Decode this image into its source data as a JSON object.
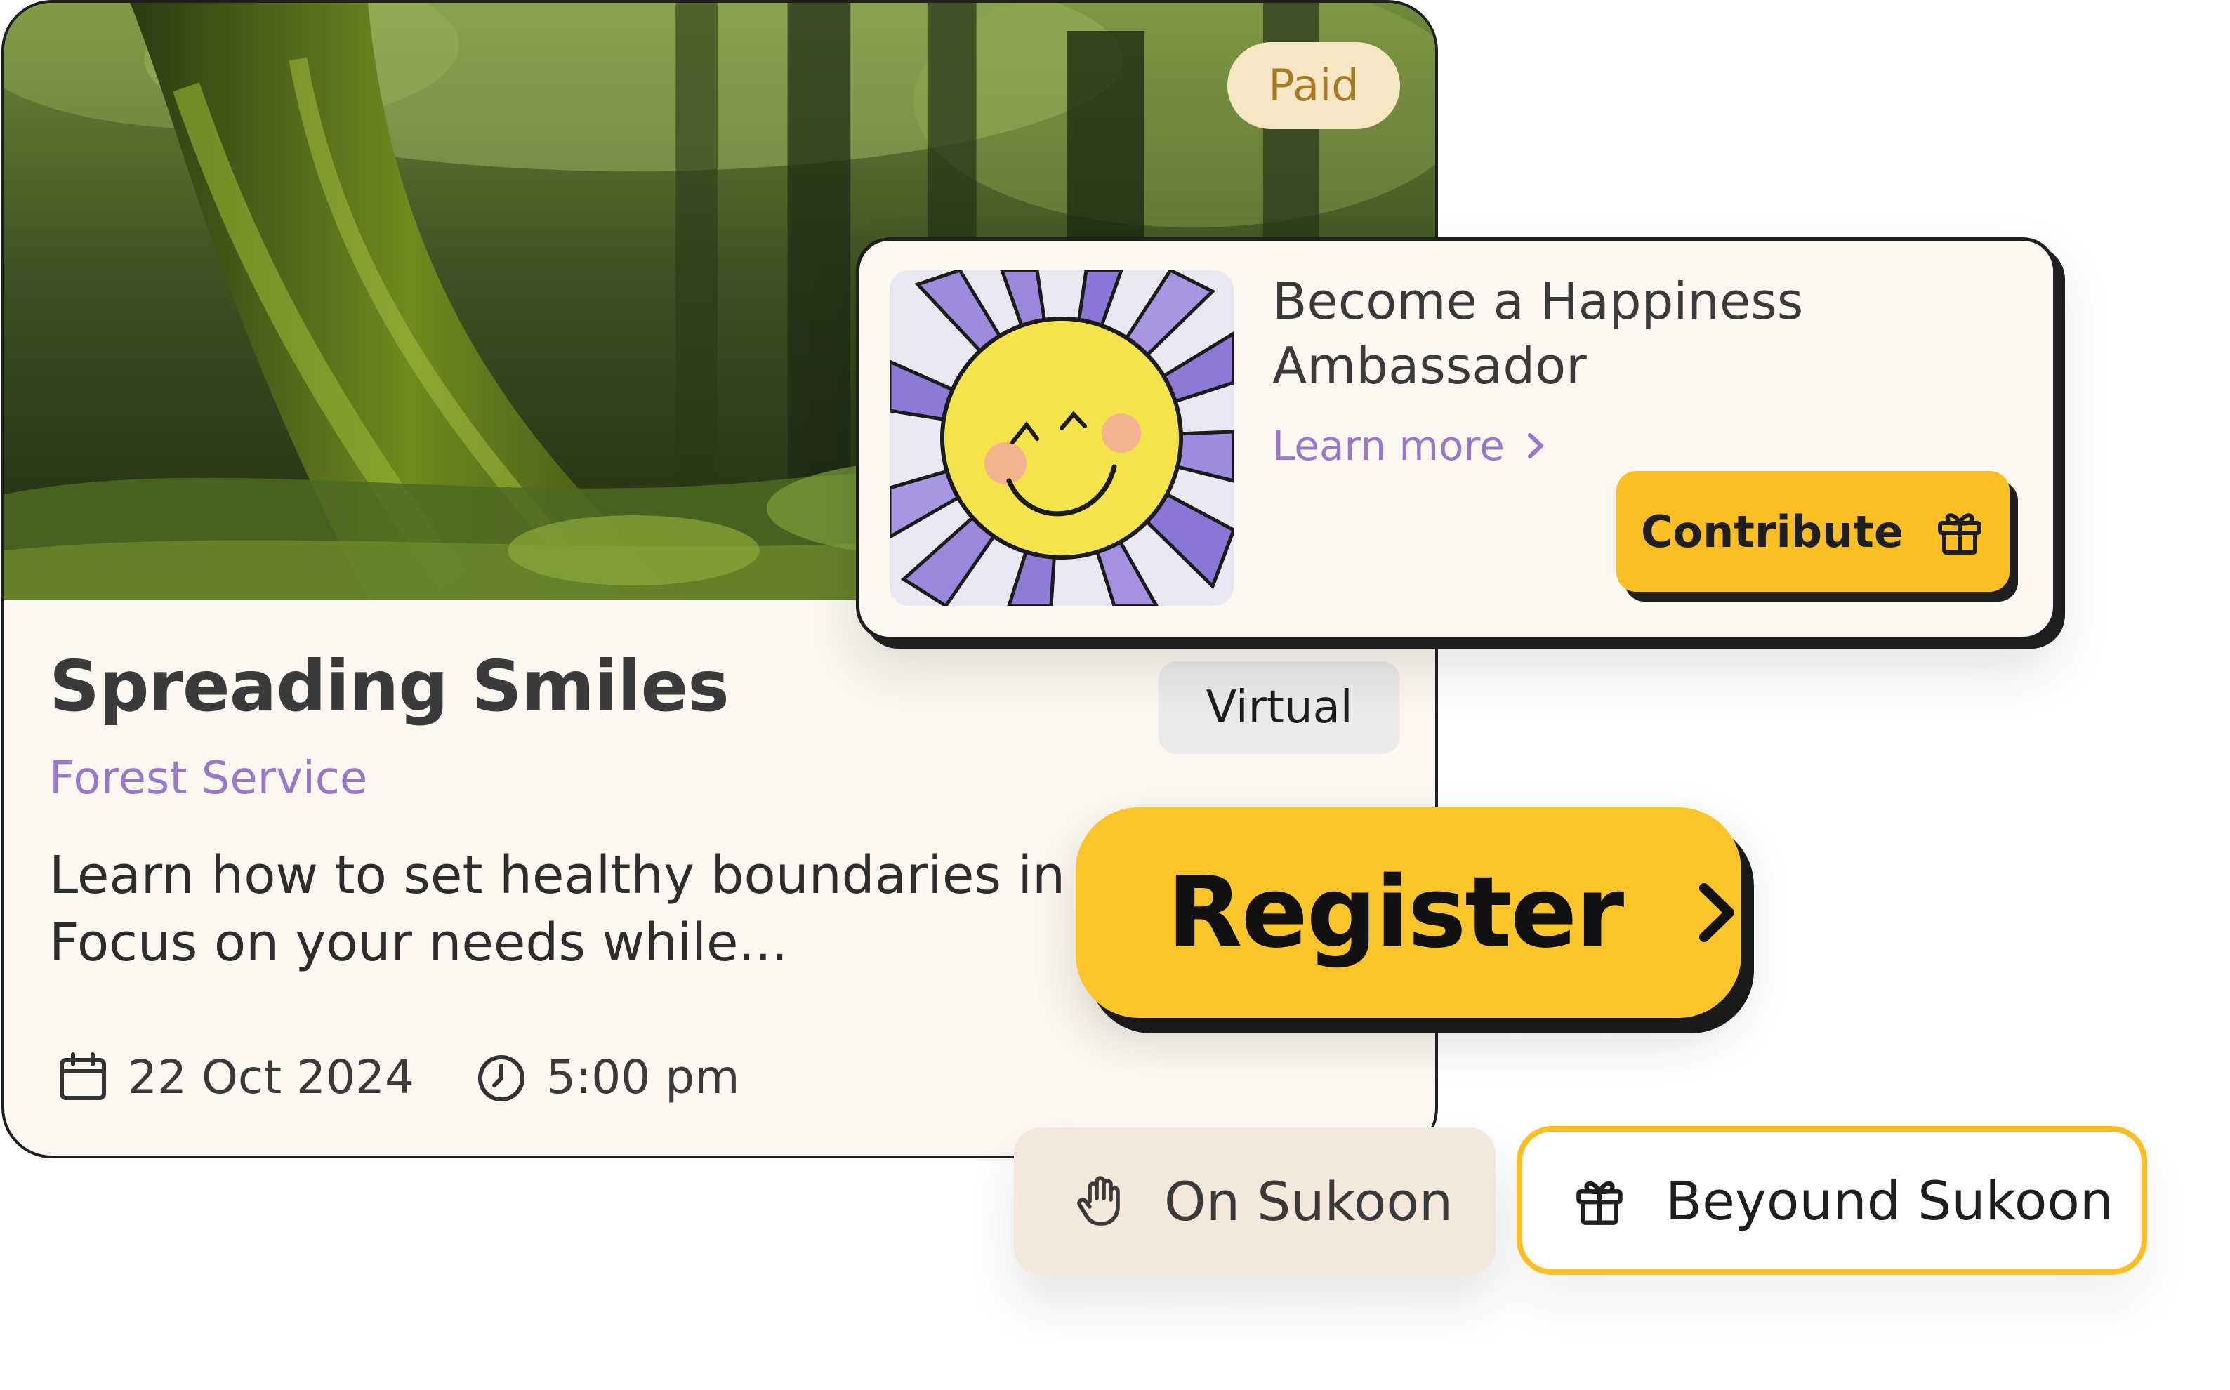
{
  "event": {
    "badge": "Paid",
    "title": "Spreading Smiles",
    "organizer": "Forest Service",
    "mode": "Virtual",
    "description_line1": "Learn how to set healthy boundaries in re",
    "description_line2": "Focus on your needs while...",
    "date": "22 Oct 2024",
    "time": "5:00 pm",
    "image": "forest-photo"
  },
  "ambassador": {
    "title": "Become a Happiness Ambassador",
    "link": "Learn more",
    "button": "Contribute",
    "image": "smiling-sun-drawing"
  },
  "register": {
    "label": "Register"
  },
  "pills": {
    "on": "On Sukoon",
    "beyond": "Beyound Sukoon"
  },
  "colors": {
    "accent_yellow": "#fbbf24",
    "purple": "#9a78c9",
    "card_bg": "#fdf7f1",
    "paid_bg": "#f7e6c4",
    "paid_text": "#a97a26"
  }
}
